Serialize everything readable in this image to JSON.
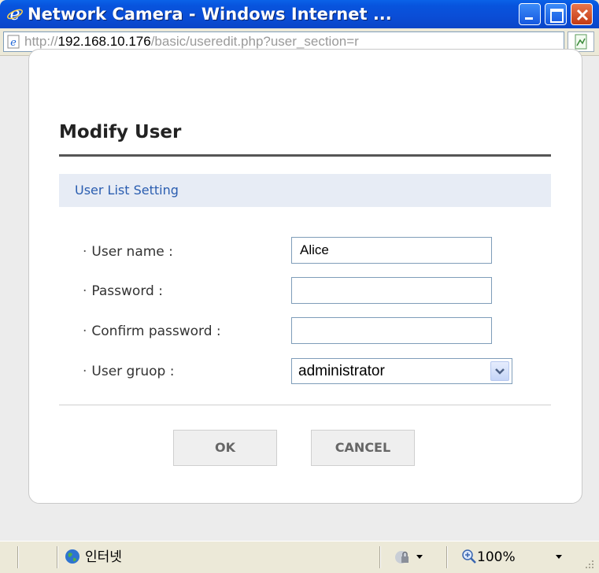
{
  "window": {
    "title": "Network Camera - Windows Internet ...",
    "colors": {
      "titlebar": "#0a4dd6",
      "close": "#c33b14"
    }
  },
  "address_bar": {
    "url_prefix": "http://",
    "url_host": "192.168.10.176",
    "url_path": "/basic/useredit.php?user_section=r"
  },
  "dialog": {
    "title": "Modify User",
    "section": "User List Setting",
    "fields": {
      "username": {
        "label": "User name :",
        "value": "Alice"
      },
      "password": {
        "label": "Password :",
        "value": ""
      },
      "confirm": {
        "label": "Confirm password :",
        "value": ""
      },
      "group": {
        "label": "User gruop :",
        "value": "administrator"
      }
    },
    "buttons": {
      "ok": "OK",
      "cancel": "CANCEL"
    },
    "bullet": "·"
  },
  "status_bar": {
    "zone": "인터넷",
    "zoom": "100%"
  },
  "icons": [
    "ie-icon",
    "minimize-icon",
    "maximize-icon",
    "close-icon",
    "page-icon",
    "compatibility-view-icon",
    "chevron-down-icon",
    "globe-icon",
    "protected-mode-icon",
    "zoom-icon",
    "resize-grip-icon"
  ]
}
